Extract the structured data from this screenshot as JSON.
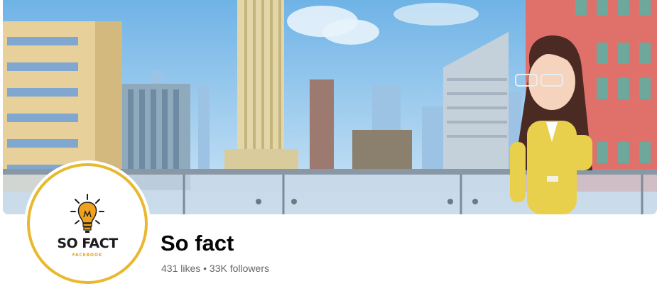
{
  "page": {
    "name": "So fact",
    "stats": "431 likes • 33K followers"
  },
  "profile_logo": {
    "brand": "SO FACT",
    "tagline": "FACEBOOK",
    "ring_color": "#e9b82c",
    "bulb_color": "#f0a21e"
  },
  "cover_photo": {
    "sky_color": "#8fc3ea",
    "subject": "cartoon avatar of a woman in a yellow suit on a balcony in front of a city skyline"
  }
}
